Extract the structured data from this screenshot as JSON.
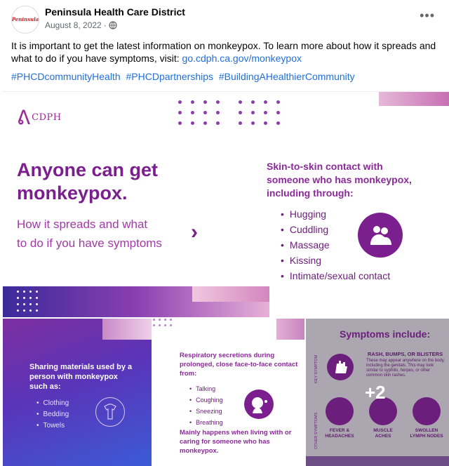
{
  "post": {
    "page_name": "Peninsula Health Care District",
    "avatar_text": "Peninsula",
    "date": "August 8, 2022",
    "separator": "·",
    "body": "It is important to get the latest information on monkeypox. To learn more about how it spreads and what to do if you have symptoms, visit: ",
    "link": "go.cdph.ca.gov/monkeypox",
    "hashtags": [
      "#PHCDcommunityHealth",
      "#PHCDpartnerships",
      "#BuildingAHealthierCommunity"
    ]
  },
  "main_image": {
    "logo_text": "CDPH",
    "headline_line1": "Anyone can get",
    "headline_line2": "monkeypox.",
    "sub_line1": "How it spreads and what",
    "sub_line2": "to do if you have symptoms",
    "chevron": "›",
    "contact_title": "Skin-to-skin contact with someone who has monkeypox, including through:",
    "contact_items": [
      "Hugging",
      "Cuddling",
      "Massage",
      "Kissing",
      "Intimate/sexual contact"
    ]
  },
  "tile1": {
    "text": "Sharing materials used by a person with monkeypox such as:",
    "items": [
      "Clothing",
      "Bedding",
      "Towels"
    ]
  },
  "tile2": {
    "title": "Respiratory secretions during prolonged, close face-to-face contact from:",
    "items": [
      "Talking",
      "Coughing",
      "Sneezing",
      "Breathing"
    ],
    "footer": "Mainly happens when living with or caring for someone who has monkeypox."
  },
  "tile3": {
    "title": "Symptoms include:",
    "rash_title": "RASH, BUMPS, OR BLISTERS",
    "rash_desc": "These may appear anywhere on the body, including the genitals. This may look similar to syphilis, herpes, or other common skin rashes.",
    "key_label": "KEY SYMPTOM",
    "other_label": "OTHER SYMPTOMS",
    "sym1": "FEVER & HEADACHES",
    "sym2": "MUSCLE ACHES",
    "sym3": "SWOLLEN LYMPH NODES",
    "more_count": "+2"
  },
  "colors": {
    "accent": "#7b1f8f",
    "link": "#216fdb"
  }
}
